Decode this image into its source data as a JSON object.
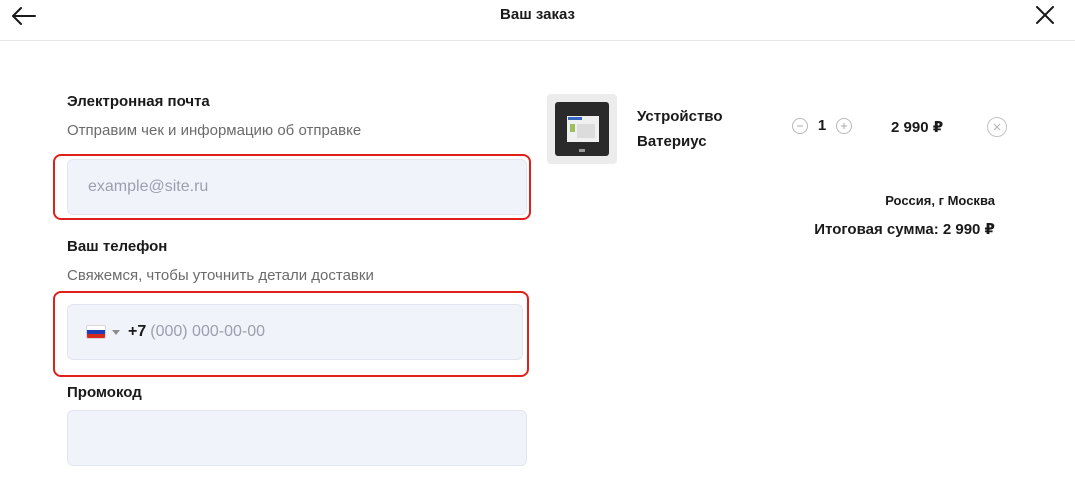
{
  "header": {
    "title": "Ваш заказ",
    "back_icon": "arrow-left-icon",
    "close_icon": "close-icon"
  },
  "form": {
    "email": {
      "label": "Электронная почта",
      "hint": "Отправим чек и информацию об отправке",
      "placeholder": "example@site.ru",
      "value": ""
    },
    "phone": {
      "label": "Ваш телефон",
      "hint": "Свяжемся, чтобы уточнить детали доставки",
      "country_flag": "russia-flag-icon",
      "prefix": "+7",
      "placeholder": "(000) 000-00-00",
      "value": ""
    },
    "promo": {
      "label": "Промокод",
      "placeholder": "",
      "value": ""
    }
  },
  "cart": {
    "items": [
      {
        "name_line1": "Устройство",
        "name_line2": "Ватериус",
        "quantity": "1",
        "price": "2 990 ₽"
      }
    ],
    "location": "Россия, г Москва",
    "total": "Итоговая сумма: 2 990 ₽"
  },
  "colors": {
    "highlight": "#e0201b",
    "input_bg": "#f1f3fb",
    "text": "#1a1a1a",
    "hint": "#6b6b6b"
  }
}
